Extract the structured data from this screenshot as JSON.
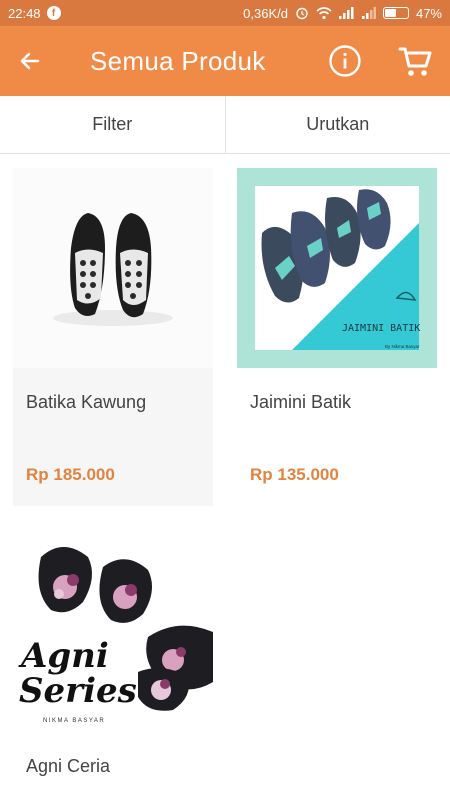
{
  "status_bar": {
    "time": "22:48",
    "network_speed": "0,36K/d",
    "battery": "47%"
  },
  "app_bar": {
    "title": "Semua Produk",
    "icons": [
      "back-arrow-icon",
      "info-icon",
      "cart-icon"
    ]
  },
  "toolbar": {
    "filter_label": "Filter",
    "sort_label": "Urutkan"
  },
  "products": [
    {
      "name": "Batika Kawung",
      "price": "Rp 185.000"
    },
    {
      "name": "Jaimini Batik",
      "price": "Rp 135.000",
      "image_caption": "JAIMINI BATIK",
      "image_brand": "By Nikma Basyar"
    },
    {
      "name": "Agni Ceria",
      "image_caption_1": "Agni",
      "image_caption_2": "Series",
      "image_brand": "NIKMA BASYAR"
    }
  ],
  "colors": {
    "app_bar": "#ef8a47",
    "status_bar": "#d9793f",
    "price": "#e0843f",
    "card_bg": "#f6f6f6"
  }
}
